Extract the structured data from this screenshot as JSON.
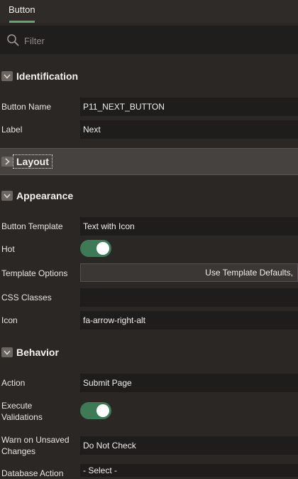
{
  "tabs": [
    {
      "label": "Button"
    }
  ],
  "filter": {
    "placeholder": "Filter"
  },
  "sections": {
    "identification": {
      "title": "Identification"
    },
    "layout": {
      "title": "Layout"
    },
    "appearance": {
      "title": "Appearance"
    },
    "behavior": {
      "title": "Behavior"
    }
  },
  "fields": {
    "button_name": {
      "label": "Button Name",
      "value": "P11_NEXT_BUTTON"
    },
    "label": {
      "label": "Label",
      "value": "Next"
    },
    "button_template": {
      "label": "Button Template",
      "value": "Text with Icon"
    },
    "hot": {
      "label": "Hot",
      "on": true
    },
    "template_options": {
      "label": "Template Options",
      "value": "Use Template Defaults,"
    },
    "css_classes": {
      "label": "CSS Classes",
      "value": ""
    },
    "icon": {
      "label": "Icon",
      "value": "fa-arrow-right-alt"
    },
    "action": {
      "label": "Action",
      "value": "Submit Page"
    },
    "execute_validations": {
      "label": "Execute Validations",
      "on": true
    },
    "warn_unsaved": {
      "label": "Warn on Unsaved Changes",
      "value": "Do Not Check"
    },
    "database_action": {
      "label": "Database Action",
      "value": "- Select -"
    }
  },
  "colors": {
    "accent": "#65a675",
    "toggle_on": "#3e7a55"
  },
  "icons": [
    "search-icon",
    "chevron-down-icon",
    "chevron-right-icon"
  ]
}
